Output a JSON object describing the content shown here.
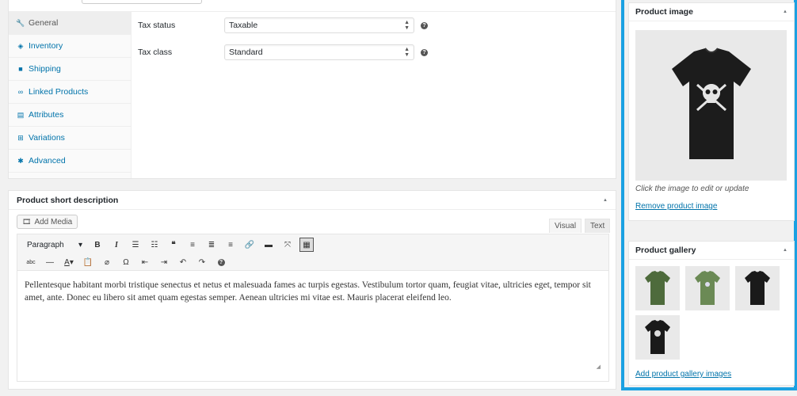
{
  "product_data": {
    "tabs": [
      {
        "label": "General",
        "icon": "wrench-icon"
      },
      {
        "label": "Inventory",
        "icon": "tag-icon"
      },
      {
        "label": "Shipping",
        "icon": "truck-icon"
      },
      {
        "label": "Linked Products",
        "icon": "link-icon"
      },
      {
        "label": "Attributes",
        "icon": "list-icon"
      },
      {
        "label": "Variations",
        "icon": "grid-icon"
      },
      {
        "label": "Advanced",
        "icon": "gear-icon"
      }
    ],
    "fields": {
      "tax_status": {
        "label": "Tax status",
        "value": "Taxable"
      },
      "tax_class": {
        "label": "Tax class",
        "value": "Standard"
      }
    }
  },
  "short_description": {
    "title": "Product short description",
    "add_media": "Add Media",
    "tab_visual": "Visual",
    "tab_text": "Text",
    "format_select": "Paragraph",
    "content": "Pellentesque habitant morbi tristique senectus et netus et malesuada fames ac turpis egestas. Vestibulum tortor quam, feugiat vitae, ultricies eget, tempor sit amet, ante. Donec eu libero sit amet quam egestas semper. Aenean ultricies mi vitae est. Mauris placerat eleifend leo."
  },
  "product_image": {
    "title": "Product image",
    "caption": "Click the image to edit or update",
    "remove_link": "Remove product image"
  },
  "product_gallery": {
    "title": "Product gallery",
    "add_link": "Add product gallery images",
    "images": [
      {
        "color": "#4e6b3c"
      },
      {
        "color": "#6b8a55"
      },
      {
        "color": "#1a1a1a"
      },
      {
        "color": "#1a1a1a"
      }
    ]
  },
  "colors": {
    "accent": "#1ba1e2",
    "link": "#0073aa"
  }
}
